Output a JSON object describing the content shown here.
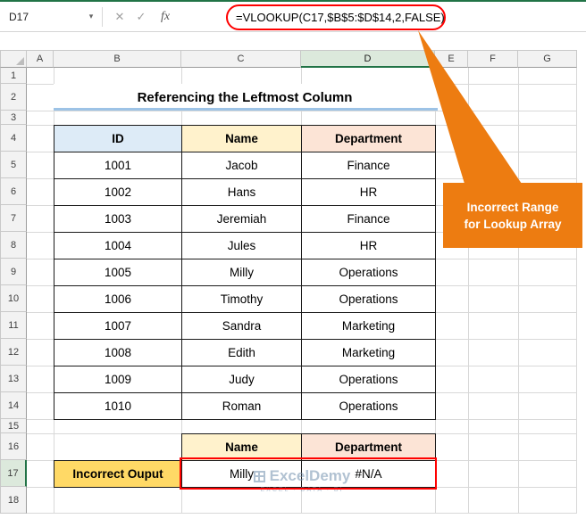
{
  "formula_bar": {
    "name_box": "D17",
    "chevron": "▾",
    "cancel": "✕",
    "confirm": "✓",
    "function_label": "fx",
    "formula": "=VLOOKUP(C17,$B$5:$D$14,2,FALSE)"
  },
  "sheet": {
    "col_headers": [
      "A",
      "B",
      "C",
      "D",
      "E",
      "F",
      "G"
    ],
    "row_headers": [
      "1",
      "2",
      "3",
      "4",
      "5",
      "6",
      "7",
      "8",
      "9",
      "10",
      "11",
      "12",
      "13",
      "14",
      "15",
      "16",
      "17",
      "18"
    ],
    "selected_cell": "D17",
    "title": "Referencing the Leftmost Column"
  },
  "table": {
    "headers": [
      "ID",
      "Name",
      "Department"
    ],
    "rows": [
      [
        "1001",
        "Jacob",
        "Finance"
      ],
      [
        "1002",
        "Hans",
        "HR"
      ],
      [
        "1003",
        "Jeremiah",
        "Finance"
      ],
      [
        "1004",
        "Jules",
        "HR"
      ],
      [
        "1005",
        "Milly",
        "Operations"
      ],
      [
        "1006",
        "Timothy",
        "Operations"
      ],
      [
        "1007",
        "Sandra",
        "Marketing"
      ],
      [
        "1008",
        "Edith",
        "Marketing"
      ],
      [
        "1009",
        "Judy",
        "Operations"
      ],
      [
        "1010",
        "Roman",
        "Operations"
      ]
    ]
  },
  "output": {
    "headers": [
      "Name",
      "Department"
    ],
    "label": "Incorrect Ouput",
    "values": [
      "Milly",
      "#N/A"
    ]
  },
  "callout": {
    "line1": "Incorrect Range",
    "line2": "for Lookup Array",
    "color": "#ED7C11"
  },
  "watermark": {
    "brand": "ExcelDemy",
    "tagline": "EXCEL · DATA · BI"
  },
  "colors": {
    "id_header_bg": "#DDEBF7",
    "name_header_bg": "#FFF2CC",
    "dept_header_bg": "#FCE4D6",
    "label_bg": "#FFD966",
    "annotation_red": "#FF0000",
    "excel_green": "#217346",
    "title_underline": "#9DC3E6"
  }
}
